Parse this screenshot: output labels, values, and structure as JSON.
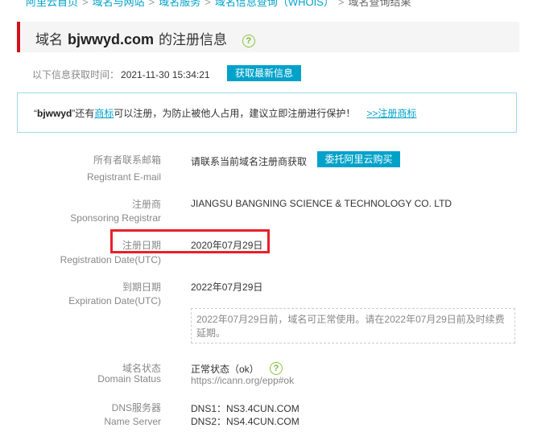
{
  "breadcrumb": {
    "items": [
      "阿里云首页",
      "域名与网站",
      "域名服务",
      "域名信息查询（WHOIS）"
    ],
    "current": "域名查询结果",
    "separator": ">"
  },
  "header": {
    "prefix": "域名",
    "domain": "bjwwyd.com",
    "suffix": "的注册信息",
    "help_icon_glyph": "?"
  },
  "fetch": {
    "label": "以下信息获取时间：",
    "time": "2021-11-30 15:34:21",
    "refresh_button": "获取最新信息"
  },
  "notice": {
    "quote_open": "“",
    "name": "bjwwyd",
    "quote_close": "”",
    "text_a": "还有",
    "link_trademark": "商标",
    "text_b": "可以注册，为防止被他人占用，建议立即注册进行保护！",
    "link_register": ">>注册商标"
  },
  "fields": {
    "email": {
      "label_cn": "所有者联系邮箱",
      "label_en": "Registrant E-mail",
      "value": "请联系当前域名注册商获取",
      "button": "委托阿里云购买"
    },
    "registrar": {
      "label_cn": "注册商",
      "label_en": "Sponsoring Registrar",
      "value": "JIANGSU BANGNING SCIENCE & TECHNOLOGY CO. LTD"
    },
    "registration_date": {
      "label_cn": "注册日期",
      "label_en": "Registration Date(UTC)",
      "value": "2020年07月29日"
    },
    "expiration_date": {
      "label_cn": "到期日期",
      "label_en": "Expiration Date(UTC)",
      "value": "2022年07月29日",
      "note": "2022年07月29日前，域名可正常使用。请在2022年07月29日前及时续费延期。"
    },
    "status": {
      "label_cn": "域名状态",
      "label_en": "Domain Status",
      "value": "正常状态（ok）",
      "url": "https://icann.org/epp#ok",
      "help_icon_glyph": "?"
    },
    "dns": {
      "label_cn": "DNS服务器",
      "label_en": "Name Server",
      "servers": [
        "DNS1：NS3.4CUN.COM",
        "DNS2：NS4.4CUN.COM"
      ]
    }
  },
  "colors": {
    "accent": "#00a2ca",
    "title_bar": "#d0121b",
    "highlight": "#e8202a",
    "help_icon": "#88c43c"
  }
}
